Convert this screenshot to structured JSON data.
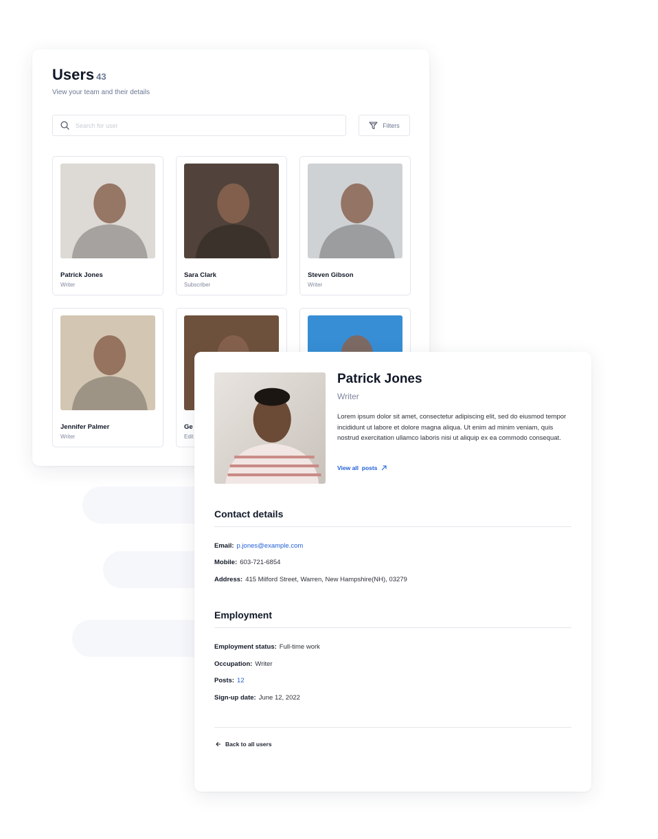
{
  "users_panel": {
    "title": "Users",
    "count": "43",
    "subtitle": "View your team and their details",
    "search": {
      "placeholder": "Search for user",
      "value": "",
      "icon": "search-icon"
    },
    "filters": {
      "label": "Filters",
      "icon": "filter-icon"
    },
    "cards": [
      {
        "name": "Patrick Jones",
        "role": "Writer",
        "photo_color": "#d9d4cf"
      },
      {
        "name": "Sara Clark",
        "role": "Subscriber",
        "photo_color": "#3a2a20"
      },
      {
        "name": "Steven Gibson",
        "role": "Writer",
        "photo_color": "#c9ccd0"
      },
      {
        "name": "Jennifer Palmer",
        "role": "Writer",
        "photo_color": "#cdbfa9"
      },
      {
        "name": "Ge",
        "role": "Edit",
        "photo_color": "#5a3a22"
      },
      {
        "name": "",
        "role": "",
        "photo_color": "#1c7fd0"
      }
    ]
  },
  "detail": {
    "name": "Patrick Jones",
    "role": "Writer",
    "bio": "Lorem ipsum dolor sit amet, consectetur adipiscing elit, sed do eiusmod tempor incididunt ut labore et dolore magna aliqua. Ut enim ad minim veniam, quis nostrud exercitation ullamco laboris nisi ut aliquip ex ea commodo consequat.",
    "view_posts": "View all  posts",
    "contact": {
      "heading": "Contact details",
      "email_label": "Email:",
      "email": "p.jones@example.com",
      "mobile_label": "Mobile:",
      "mobile": "603-721-6854",
      "address_label": "Address:",
      "address": "415 Milford Street, Warren, New Hampshire(NH), 03279"
    },
    "employment": {
      "heading": "Employment",
      "status_label": "Employment status:",
      "status": "Full-time work",
      "occupation_label": "Occupation:",
      "occupation": "Writer",
      "posts_label": "Posts:",
      "posts": "12",
      "signup_label": "Sign-up date:",
      "signup": "June 12, 2022"
    },
    "back": "Back to all users"
  },
  "colors": {
    "accent": "#1f5fd6",
    "muted": "#6b7793",
    "pill": "#f6f7fb"
  }
}
